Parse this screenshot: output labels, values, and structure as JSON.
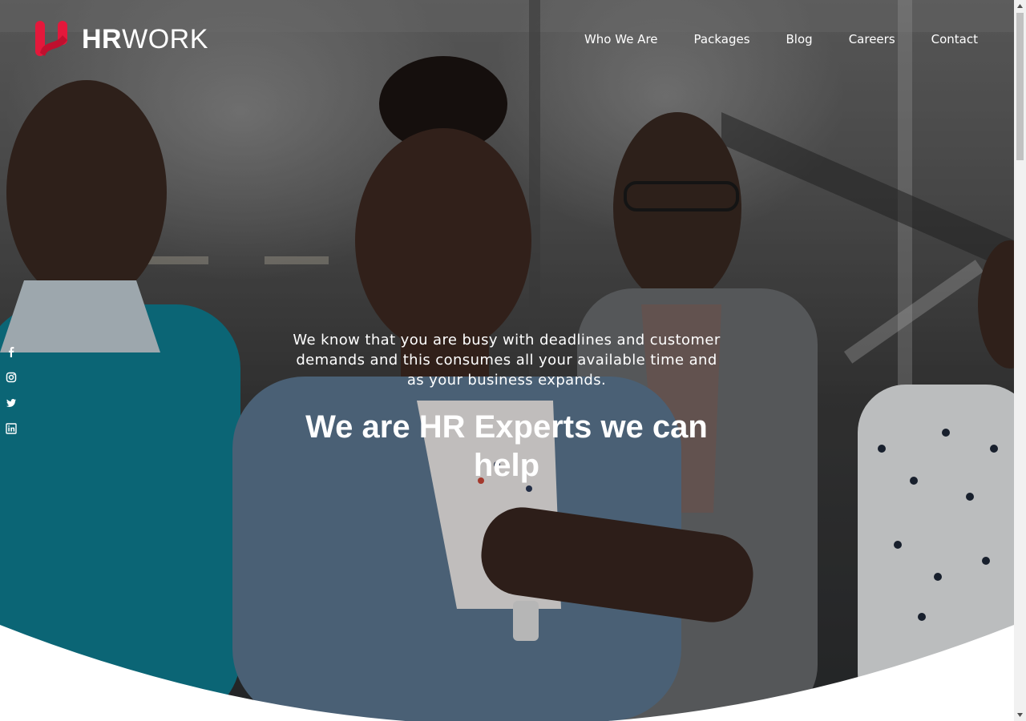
{
  "brand": {
    "name_strong": "HR",
    "name_light": "WORK",
    "accent_color": "#e4183b"
  },
  "nav": {
    "items": [
      {
        "label": "Who We Are"
      },
      {
        "label": "Packages"
      },
      {
        "label": "Blog"
      },
      {
        "label": "Careers"
      },
      {
        "label": "Contact"
      }
    ]
  },
  "social": {
    "icons": [
      "facebook-icon",
      "instagram-icon",
      "twitter-icon",
      "linkedin-icon"
    ]
  },
  "hero": {
    "intro": "We know that you are busy with deadlines and customer demands and this consumes all your available time and as your business expands.",
    "heading": "We are HR Experts we can help"
  }
}
